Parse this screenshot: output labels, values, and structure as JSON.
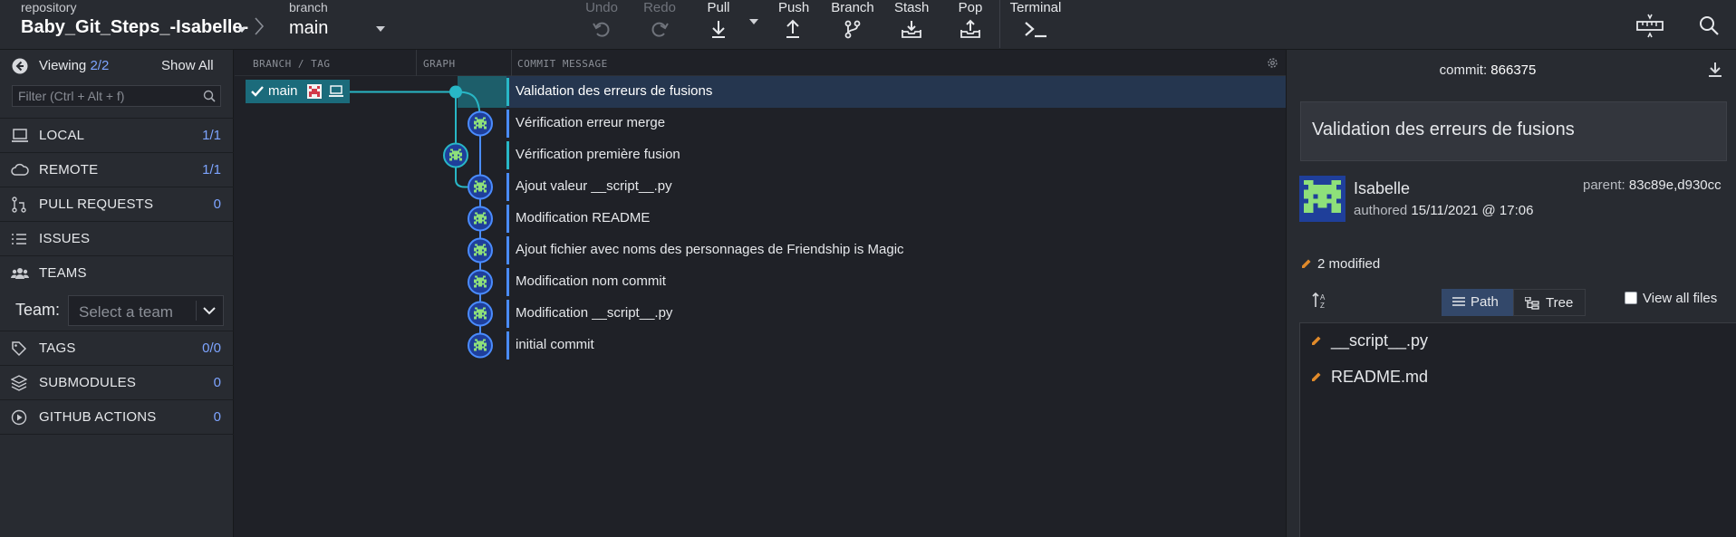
{
  "toolbar": {
    "repo_label": "repository",
    "repo_name": "Baby_Git_Steps_-Isabelle-",
    "branch_label": "branch",
    "branch_name": "main",
    "actions": {
      "undo": "Undo",
      "redo": "Redo",
      "pull": "Pull",
      "push": "Push",
      "branch": "Branch",
      "stash": "Stash",
      "pop": "Pop",
      "terminal": "Terminal"
    },
    "right_icons": [
      "tape-measure-icon",
      "search-icon"
    ]
  },
  "sidebar": {
    "viewing_label": "Viewing",
    "viewing_count": "2/2",
    "show_all": "Show All",
    "filter_placeholder": "Filter (Ctrl + Alt + f)",
    "sections": [
      {
        "label": "LOCAL",
        "count": "1/1",
        "icon": "laptop-icon"
      },
      {
        "label": "REMOTE",
        "count": "1/1",
        "icon": "cloud-icon"
      },
      {
        "label": "PULL REQUESTS",
        "count": "0",
        "icon": "pull-request-icon"
      },
      {
        "label": "ISSUES",
        "count": "",
        "icon": "list-icon"
      },
      {
        "label": "TEAMS",
        "count": "",
        "icon": "users-icon"
      },
      {
        "label": "TAGS",
        "count": "0/0",
        "icon": "tag-icon"
      },
      {
        "label": "SUBMODULES",
        "count": "0",
        "icon": "layers-icon"
      },
      {
        "label": "GITHUB ACTIONS",
        "count": "0",
        "icon": "play-circle-icon"
      }
    ],
    "team_label": "Team:",
    "team_placeholder": "Select a team"
  },
  "graph": {
    "headers": {
      "branch_tag": "BRANCH / TAG",
      "graph": "GRAPH",
      "message": "COMMIT MESSAGE"
    },
    "branch_pill": "main",
    "commits": [
      {
        "message": "Validation des erreurs de fusions",
        "lane": 0,
        "selected": true,
        "merge": true
      },
      {
        "message": "Vérification erreur merge",
        "lane": 1
      },
      {
        "message": "Vérification première fusion",
        "lane": 0
      },
      {
        "message": "Ajout valeur __script__.py",
        "lane": 1
      },
      {
        "message": "Modification README",
        "lane": 1
      },
      {
        "message": "Ajout fichier avec noms des personnages de Friendship is Magic",
        "lane": 1
      },
      {
        "message": "Modification nom commit",
        "lane": 1
      },
      {
        "message": "Modification __script__.py",
        "lane": 1
      },
      {
        "message": "initial commit",
        "lane": 1
      }
    ]
  },
  "detail": {
    "commit_label": "commit:",
    "commit_sha": "866375",
    "title": "Validation des erreurs de fusions",
    "author": "Isabelle",
    "authored_label": "authored",
    "authored_date": "15/11/2021 @ 17:06",
    "parent_label": "parent:",
    "parent_shas": "83c89e,d930cc",
    "modified_text": "2 modified",
    "path_label": "Path",
    "tree_label": "Tree",
    "view_all_label": "View all files",
    "files": [
      "__script__.py",
      "README.md"
    ]
  },
  "colors": {
    "accent_blue": "#4a8cff",
    "accent_teal": "#28b7c6",
    "selected_row": "#25364f",
    "count_blue": "#7da4ff",
    "modified_orange": "#e08a2a"
  }
}
